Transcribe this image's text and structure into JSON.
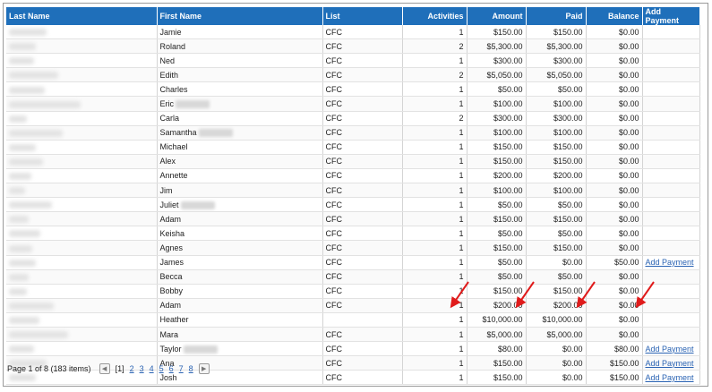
{
  "table": {
    "headers": [
      "Last Name",
      "First Name",
      "List",
      "Activities",
      "Amount",
      "Paid",
      "Balance",
      "Add Payment"
    ],
    "rows": [
      {
        "first": "Jamie",
        "list": "CFC",
        "activities": "1",
        "amount": "$150.00",
        "paid": "$150.00",
        "balance": "$0.00",
        "add": ""
      },
      {
        "first": "Roland",
        "list": "CFC",
        "activities": "2",
        "amount": "$5,300.00",
        "paid": "$5,300.00",
        "balance": "$0.00",
        "add": ""
      },
      {
        "first": "Ned",
        "list": "CFC",
        "activities": "1",
        "amount": "$300.00",
        "paid": "$300.00",
        "balance": "$0.00",
        "add": ""
      },
      {
        "first": "Edith",
        "list": "CFC",
        "activities": "2",
        "amount": "$5,050.00",
        "paid": "$5,050.00",
        "balance": "$0.00",
        "add": ""
      },
      {
        "first": "Charles",
        "list": "CFC",
        "activities": "1",
        "amount": "$50.00",
        "paid": "$50.00",
        "balance": "$0.00",
        "add": ""
      },
      {
        "first": "Eric",
        "list": "CFC",
        "activities": "1",
        "amount": "$100.00",
        "paid": "$100.00",
        "balance": "$0.00",
        "add": ""
      },
      {
        "first": "Carla",
        "list": "CFC",
        "activities": "2",
        "amount": "$300.00",
        "paid": "$300.00",
        "balance": "$0.00",
        "add": ""
      },
      {
        "first": "Samantha",
        "list": "CFC",
        "activities": "1",
        "amount": "$100.00",
        "paid": "$100.00",
        "balance": "$0.00",
        "add": ""
      },
      {
        "first": "Michael",
        "list": "CFC",
        "activities": "1",
        "amount": "$150.00",
        "paid": "$150.00",
        "balance": "$0.00",
        "add": ""
      },
      {
        "first": "Alex",
        "list": "CFC",
        "activities": "1",
        "amount": "$150.00",
        "paid": "$150.00",
        "balance": "$0.00",
        "add": ""
      },
      {
        "first": "Annette",
        "list": "CFC",
        "activities": "1",
        "amount": "$200.00",
        "paid": "$200.00",
        "balance": "$0.00",
        "add": ""
      },
      {
        "first": "Jim",
        "list": "CFC",
        "activities": "1",
        "amount": "$100.00",
        "paid": "$100.00",
        "balance": "$0.00",
        "add": ""
      },
      {
        "first": "Juliet",
        "list": "CFC",
        "activities": "1",
        "amount": "$50.00",
        "paid": "$50.00",
        "balance": "$0.00",
        "add": ""
      },
      {
        "first": "Adam",
        "list": "CFC",
        "activities": "1",
        "amount": "$150.00",
        "paid": "$150.00",
        "balance": "$0.00",
        "add": ""
      },
      {
        "first": "Keisha",
        "list": "CFC",
        "activities": "1",
        "amount": "$50.00",
        "paid": "$50.00",
        "balance": "$0.00",
        "add": ""
      },
      {
        "first": "Agnes",
        "list": "CFC",
        "activities": "1",
        "amount": "$150.00",
        "paid": "$150.00",
        "balance": "$0.00",
        "add": ""
      },
      {
        "first": "James",
        "list": "CFC",
        "activities": "1",
        "amount": "$50.00",
        "paid": "$0.00",
        "balance": "$50.00",
        "add": "Add Payment"
      },
      {
        "first": "Becca",
        "list": "CFC",
        "activities": "1",
        "amount": "$50.00",
        "paid": "$50.00",
        "balance": "$0.00",
        "add": ""
      },
      {
        "first": "Bobby",
        "list": "CFC",
        "activities": "1",
        "amount": "$150.00",
        "paid": "$150.00",
        "balance": "$0.00",
        "add": ""
      },
      {
        "first": "Adam",
        "list": "CFC",
        "activities": "1",
        "amount": "$200.00",
        "paid": "$200.00",
        "balance": "$0.00",
        "add": ""
      },
      {
        "first": "Heather",
        "list": "",
        "activities": "1",
        "amount": "$10,000.00",
        "paid": "$10,000.00",
        "balance": "$0.00",
        "add": ""
      },
      {
        "first": "Mara",
        "list": "CFC",
        "activities": "1",
        "amount": "$5,000.00",
        "paid": "$5,000.00",
        "balance": "$0.00",
        "add": ""
      },
      {
        "first": "Taylor",
        "list": "CFC",
        "activities": "1",
        "amount": "$80.00",
        "paid": "$0.00",
        "balance": "$80.00",
        "add": "Add Payment"
      },
      {
        "first": "Ana",
        "list": "CFC",
        "activities": "1",
        "amount": "$150.00",
        "paid": "$0.00",
        "balance": "$150.00",
        "add": "Add Payment"
      },
      {
        "first": "Josh",
        "list": "CFC",
        "activities": "1",
        "amount": "$150.00",
        "paid": "$0.00",
        "balance": "$150.00",
        "add": "Add Payment"
      }
    ]
  },
  "pager": {
    "info": "Page 1 of 8 (183 items)",
    "current": "[1]",
    "pages": [
      "2",
      "3",
      "4",
      "5",
      "6",
      "7",
      "8"
    ],
    "prev_icon": "chevron-left-icon",
    "next_icon": "chevron-right-icon"
  },
  "colors": {
    "header_bg": "#1f6fba",
    "link": "#2a63b3",
    "annotation_arrow": "#e01b1b"
  }
}
